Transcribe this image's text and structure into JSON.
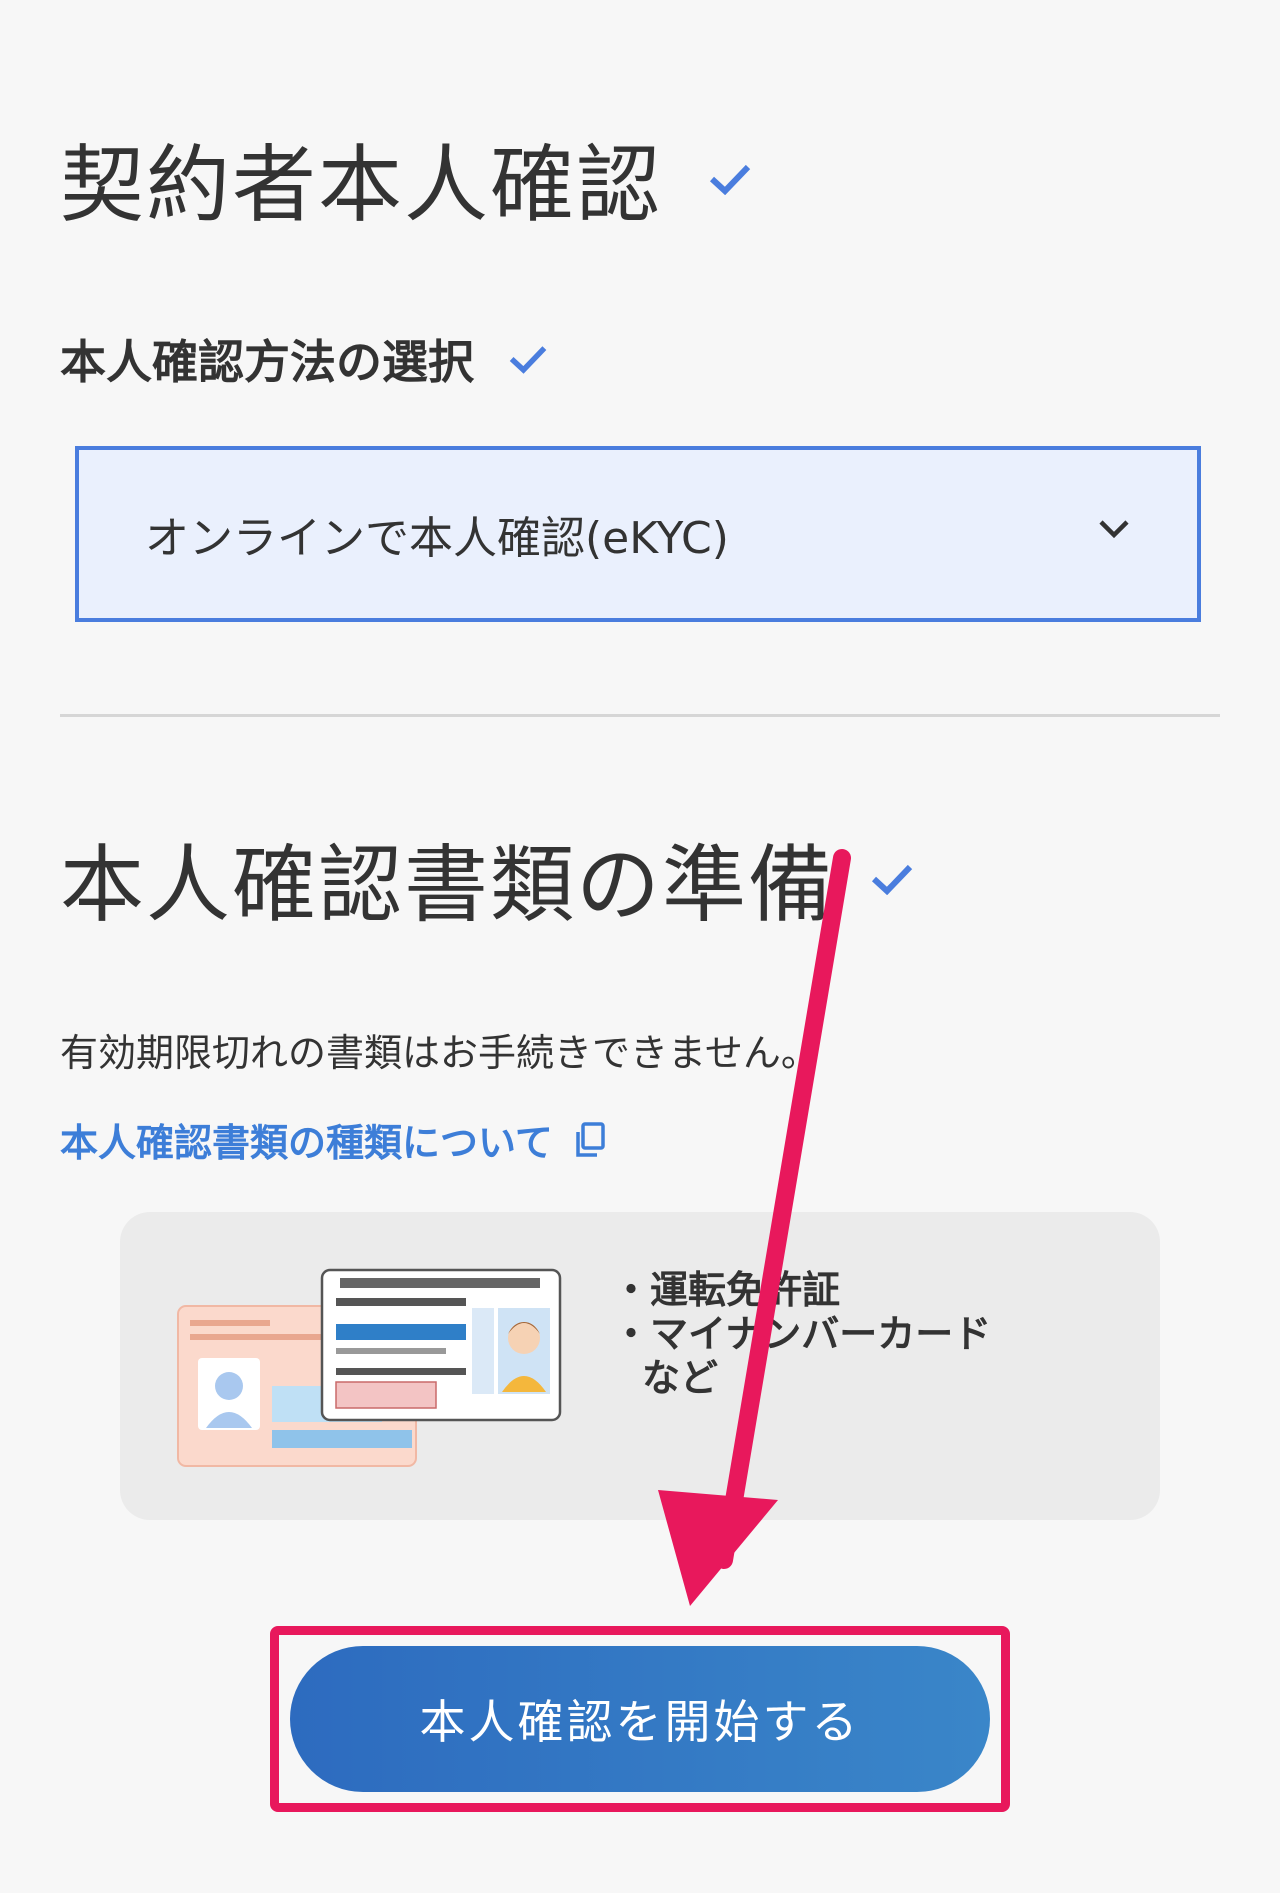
{
  "section1": {
    "title": "契約者本人確認",
    "check_icon": "check-icon"
  },
  "method": {
    "label": "本人確認方法の選択",
    "select_value": "オンラインで本人確認(eKYC)",
    "chevron_icon": "chevron-down-icon"
  },
  "section2": {
    "title": "本人確認書類の準備",
    "note": "有効期限切れの書類はお手続きできません。",
    "link_text": "本人確認書類の種類について",
    "link_icon": "external-link-icon",
    "documents": [
      "・運転免許証",
      "・マイナンバーカード",
      "など"
    ]
  },
  "cta": {
    "label": "本人確認を開始する"
  },
  "colors": {
    "accent": "#4a7dde",
    "link": "#3d7ed8",
    "highlight": "#e8185c",
    "button": "#2d6bbf"
  }
}
